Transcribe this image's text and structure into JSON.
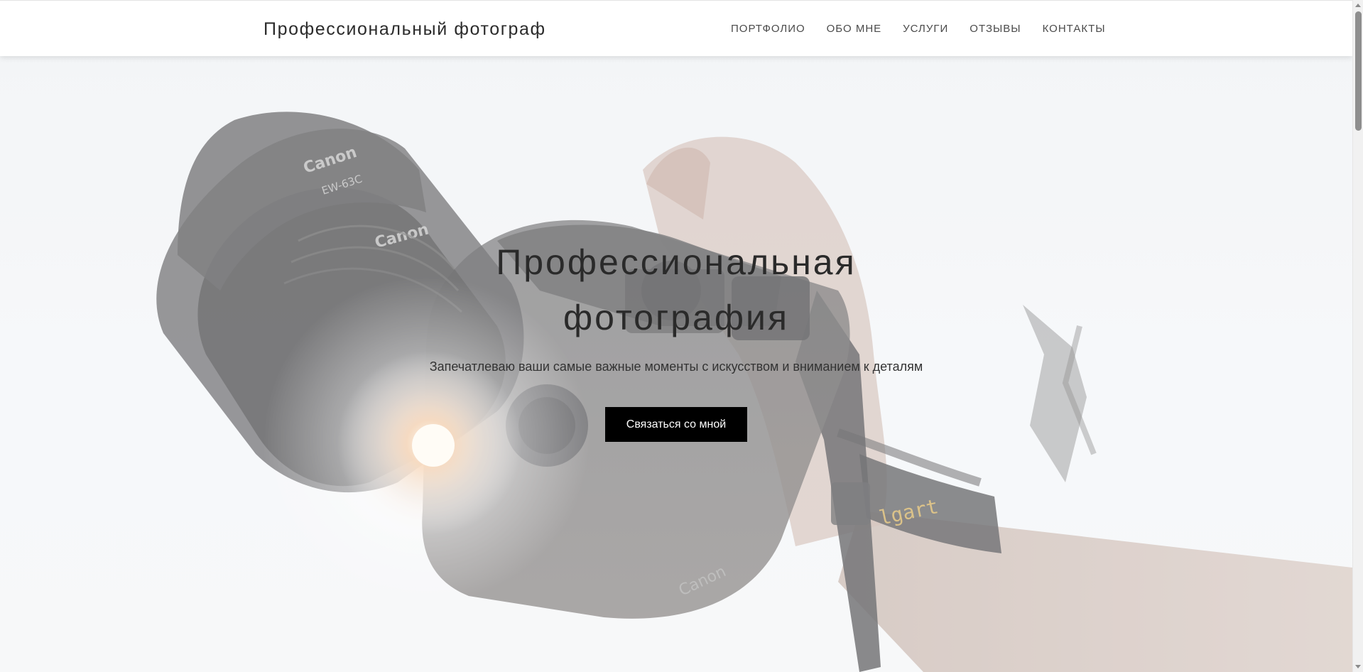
{
  "header": {
    "brand": "Профессиональный фотограф",
    "nav": [
      {
        "label": "ПОРТФОЛИО"
      },
      {
        "label": "ОБО МНЕ"
      },
      {
        "label": "УСЛУГИ"
      },
      {
        "label": "ОТЗЫВЫ"
      },
      {
        "label": "КОНТАКТЫ"
      }
    ]
  },
  "hero": {
    "title_line1": "Профессиональная",
    "title_line2": "фотография",
    "subtitle": "Запечатлеваю ваши самые важные моменты с искусством и вниманием к деталям",
    "cta_label": "Связаться со мной",
    "image_description": "hand holding a Canon DSLR camera against a bright sky with sun flare",
    "camera_brand_text": "Canon",
    "lens_hood_text": "EW-63C",
    "bracelet_text": "lgart"
  },
  "colors": {
    "header_bg": "#ffffff",
    "cta_bg": "#000000",
    "cta_text": "#ffffff",
    "text_dark": "#2a2a2a"
  }
}
